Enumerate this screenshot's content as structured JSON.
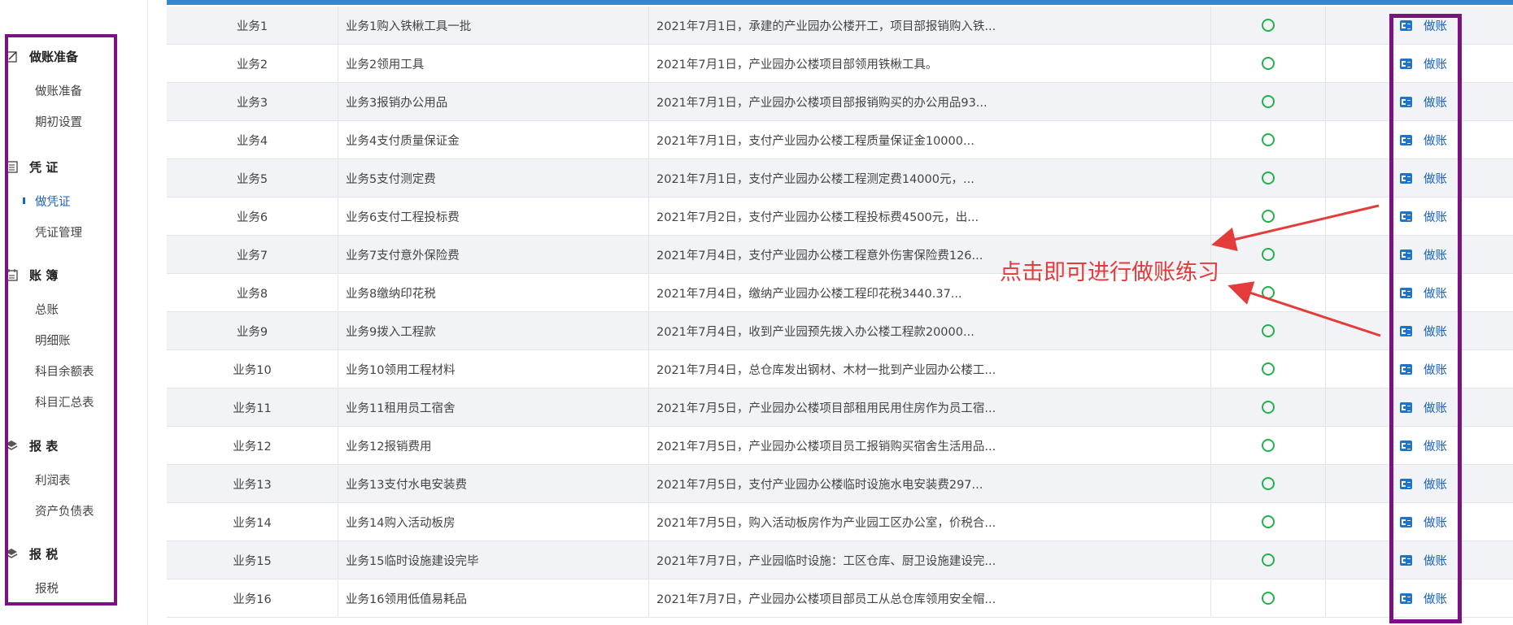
{
  "sidebar": {
    "groups": [
      {
        "title": "做账准备",
        "icon": "edit-icon",
        "items": [
          {
            "label": "做账准备"
          },
          {
            "label": "期初设置"
          }
        ]
      },
      {
        "title": "凭  证",
        "icon": "list-icon",
        "items": [
          {
            "label": "做凭证",
            "active": true
          },
          {
            "label": "凭证管理"
          }
        ]
      },
      {
        "title": "账  簿",
        "icon": "calendar-icon",
        "items": [
          {
            "label": "总账"
          },
          {
            "label": "明细账"
          },
          {
            "label": "科目余额表"
          },
          {
            "label": "科目汇总表"
          }
        ]
      },
      {
        "title": "报  表",
        "icon": "layers-icon",
        "items": [
          {
            "label": "利润表"
          },
          {
            "label": "资产负债表"
          }
        ]
      },
      {
        "title": "报  税",
        "icon": "layers-icon",
        "items": [
          {
            "label": "报税"
          }
        ]
      }
    ]
  },
  "table": {
    "action_label": "做账",
    "rows": [
      {
        "name": "业务1",
        "title": "业务1购入铁楸工具一批",
        "desc": "2021年7月1日，承建的产业园办公楼开工，项目部报销购入铁..."
      },
      {
        "name": "业务2",
        "title": "业务2领用工具",
        "desc": "2021年7月1日，产业园办公楼项目部领用铁楸工具。"
      },
      {
        "name": "业务3",
        "title": "业务3报销办公用品",
        "desc": "2021年7月1日，产业园办公楼项目部报销购买的办公用品93..."
      },
      {
        "name": "业务4",
        "title": "业务4支付质量保证金",
        "desc": "2021年7月1日，支付产业园办公楼工程质量保证金10000..."
      },
      {
        "name": "业务5",
        "title": "业务5支付测定费",
        "desc": "2021年7月1日，支付产业园办公楼工程测定费14000元，..."
      },
      {
        "name": "业务6",
        "title": "业务6支付工程投标费",
        "desc": "2021年7月2日，支付产业园办公楼工程投标费4500元，出..."
      },
      {
        "name": "业务7",
        "title": "业务7支付意外保险费",
        "desc": "2021年7月4日，支付产业园办公楼工程意外伤害保险费126..."
      },
      {
        "name": "业务8",
        "title": "业务8缴纳印花税",
        "desc": "2021年7月4日，缴纳产业园办公楼工程印花税3440.37..."
      },
      {
        "name": "业务9",
        "title": "业务9拨入工程款",
        "desc": "2021年7月4日，收到产业园预先拨入办公楼工程款20000..."
      },
      {
        "name": "业务10",
        "title": "业务10领用工程材料",
        "desc": "2021年7月4日，总仓库发出钢材、木材一批到产业园办公楼工..."
      },
      {
        "name": "业务11",
        "title": "业务11租用员工宿舍",
        "desc": "2021年7月5日，产业园办公楼项目部租用民用住房作为员工宿..."
      },
      {
        "name": "业务12",
        "title": "业务12报销费用",
        "desc": "2021年7月5日，产业园办公楼项目员工报销购买宿舍生活用品..."
      },
      {
        "name": "业务13",
        "title": "业务13支付水电安装费",
        "desc": "2021年7月5日，支付产业园办公楼临时设施水电安装费297..."
      },
      {
        "name": "业务14",
        "title": "业务14购入活动板房",
        "desc": "2021年7月5日，购入活动板房作为产业园工区办公室，价税合..."
      },
      {
        "name": "业务15",
        "title": "业务15临时设施建设完毕",
        "desc": "2021年7月7日，产业园临时设施：工区仓库、厨卫设施建设完..."
      },
      {
        "name": "业务16",
        "title": "业务16领用低值易耗品",
        "desc": "2021年7月7日，产业园办公楼项目部员工从总仓库领用安全帽..."
      }
    ]
  },
  "annotation": {
    "text": "点击即可进行做账练习",
    "color": "#e43b3b"
  },
  "colors": {
    "frame": "#7b1282",
    "accent": "#1a63b7",
    "status": "#22b14c",
    "header": "#2f86d3"
  }
}
